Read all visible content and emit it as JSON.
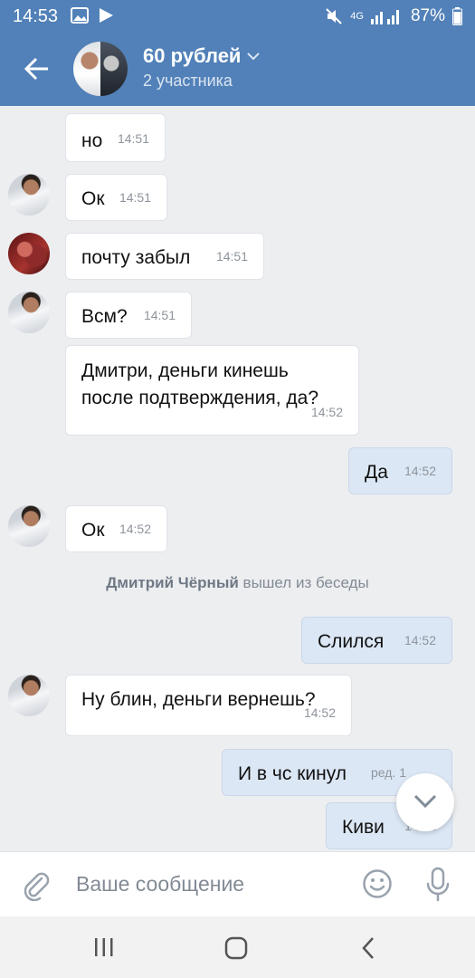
{
  "status_bar": {
    "time": "14:53",
    "battery": "87%",
    "network": "4G"
  },
  "header": {
    "title": "60 рублей",
    "subtitle": "2 участника"
  },
  "messages": [
    {
      "text": "но",
      "time": "14:51"
    },
    {
      "text": "Ок",
      "time": "14:51"
    },
    {
      "text": "почту забыл",
      "time": "14:51"
    },
    {
      "text": "Всм?",
      "time": "14:51"
    },
    {
      "text_line1": "Дмитри, деньги кинешь",
      "text_line2": "после подтверждения, да?",
      "time": "14:52"
    },
    {
      "text": "Да",
      "time": "14:52"
    },
    {
      "text": "Ок",
      "time": "14:52"
    },
    {
      "text": "Слился",
      "time": "14:52"
    },
    {
      "text": "Ну блин, деньги вернешь?",
      "time": "14:52"
    },
    {
      "text": "И в чс кинул",
      "time": "ред. 1"
    },
    {
      "text": "Киви",
      "time": "14:52"
    }
  ],
  "system_message": {
    "name": "Дмитрий Чёрный",
    "action": "вышел из беседы"
  },
  "composer": {
    "placeholder": "Ваше сообщение"
  },
  "colors": {
    "header": "#5181b8",
    "background": "#edeef0",
    "outgoing_bubble": "#dce7f5"
  }
}
